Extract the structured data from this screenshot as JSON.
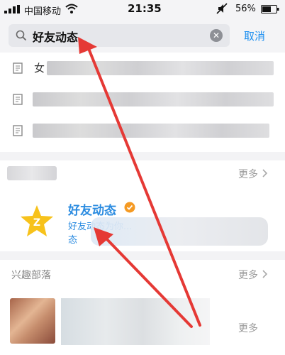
{
  "status_bar": {
    "carrier": "中国移动",
    "time": "21:35",
    "battery": "56%"
  },
  "search": {
    "query": "好友动态",
    "cancel_label": "取消"
  },
  "history": {
    "first_row_lead": "女"
  },
  "public_section": {
    "more_label": "更多"
  },
  "public_account": {
    "name": "好友动态",
    "desc_line1": "好友动态为你...",
    "desc_line2": "态"
  },
  "tribe_section": {
    "title": "兴趣部落",
    "more_label": "更多"
  },
  "tribe_item": {
    "more_label": "更多"
  },
  "colors": {
    "accent": "#1d8ff0",
    "link_blue": "#2a8be0",
    "arrow_red": "#e53935",
    "qzone_yellow": "#f7c21b"
  }
}
